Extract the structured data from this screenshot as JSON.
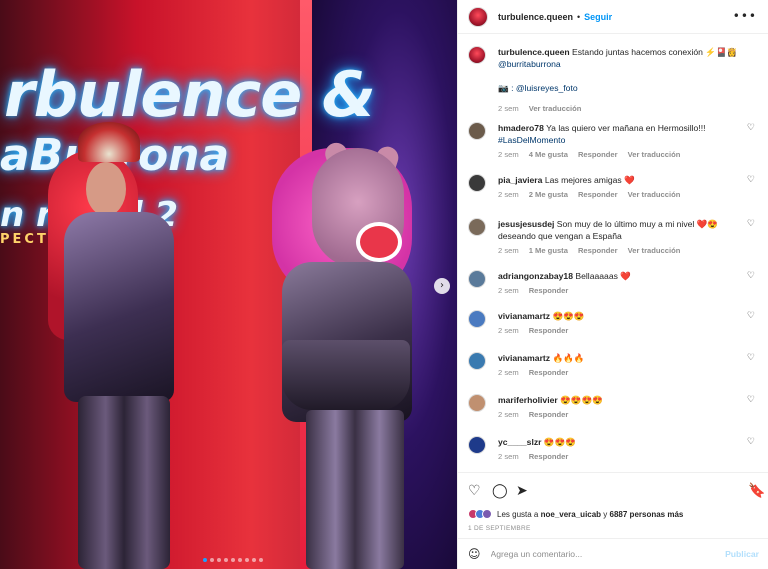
{
  "post": {
    "username": "turbulence.queen",
    "follow_label": "Seguir",
    "more_icon": "more-horizontal-icon",
    "caption": "Estando juntas hacemos conexión ⚡️🎴👸",
    "caption_mention": "@burritaburrona",
    "caption_credit_icon": "📷",
    "caption_credit": ": @luisreyes_foto",
    "caption_time": "2 sem",
    "caption_translation": "Ver traducción"
  },
  "media": {
    "sign_line1": "rbulence &",
    "sign_line2": "aBurrona",
    "sign_line3": "n ni   Vol 2",
    "sign_line4": "PECT",
    "carousel_next": "›",
    "slide_count": 9,
    "active_slide": 0
  },
  "comments": [
    {
      "user": "hmadero78",
      "text": "Ya las quiero ver mañana en Hermosillo!!! ",
      "tag": "#LasDelMomento",
      "time": "2 sem",
      "likes": "4 Me gusta",
      "reply": "Responder",
      "translate": "Ver traducción"
    },
    {
      "user": "pia_javiera",
      "text": "Las mejores amigas ❤️",
      "time": "2 sem",
      "likes": "2 Me gusta",
      "reply": "Responder",
      "translate": "Ver traducción"
    },
    {
      "user": "jesusjesusdej",
      "text": "Son muy de lo último muy a mi nivel ❤️😍 deseando que vengan a España",
      "time": "2 sem",
      "likes": "1 Me gusta",
      "reply": "Responder",
      "translate": "Ver traducción"
    },
    {
      "user": "adriangonzabay18",
      "text": "Bellaaaaas ❤️",
      "time": "2 sem",
      "reply": "Responder"
    },
    {
      "user": "vivianamartz",
      "text": "😍😍😍",
      "time": "2 sem",
      "reply": "Responder"
    },
    {
      "user": "vivianamartz",
      "text": "🔥🔥🔥",
      "time": "2 sem",
      "reply": "Responder"
    },
    {
      "user": "mariferholivier",
      "text": "😍😍😍😍",
      "time": "2 sem",
      "reply": "Responder"
    },
    {
      "user": "yc____slzr",
      "text": "😍😍😍",
      "time": "2 sem",
      "reply": "Responder"
    }
  ],
  "actions": {
    "like_icon": "heart-icon",
    "comment_icon": "comment-icon",
    "share_icon": "share-icon",
    "save_icon": "bookmark-icon",
    "likes_prefix": "Les gusta a ",
    "likes_user": "noe_vera_uicab",
    "likes_middle": " y ",
    "likes_count": "6887 personas más",
    "date": "1 DE SEPTIEMBRE"
  },
  "add_comment": {
    "placeholder": "Agrega un comentario...",
    "publish_label": "Publicar",
    "emoji_icon": "emoji-icon"
  },
  "colors": {
    "link": "#0095f6",
    "hashtag": "#00376b",
    "muted": "#8e8e8e"
  }
}
